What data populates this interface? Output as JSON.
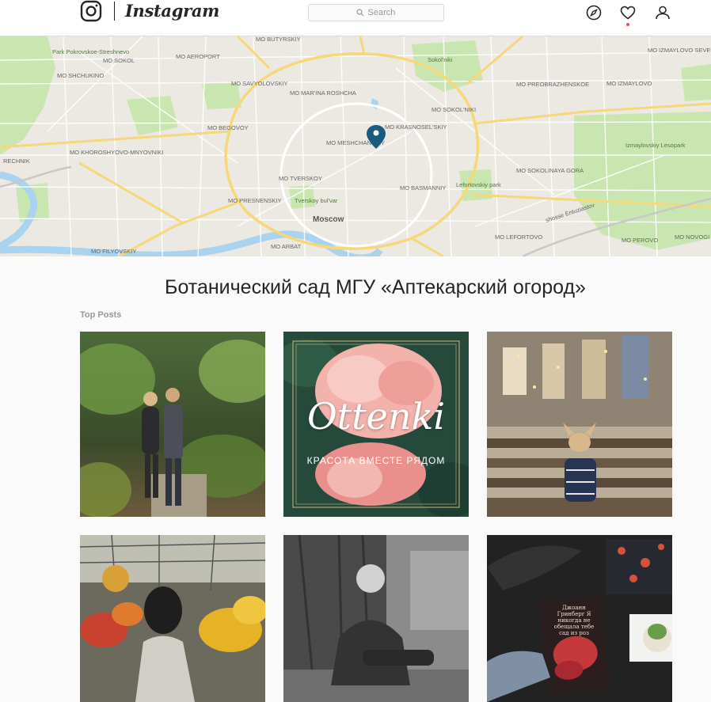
{
  "header": {
    "wordmark": "Instagram",
    "search_placeholder": "Search"
  },
  "map": {
    "labels": [
      {
        "text": "MO BUTYRSKIY"
      },
      {
        "text": "MO SOKOL"
      },
      {
        "text": "MO AEROPORT"
      },
      {
        "text": "MO SHCHUKINO"
      },
      {
        "text": "MO SAVYOLOVSKIY"
      },
      {
        "text": "MO MAR'INA ROSHCHA"
      },
      {
        "text": "MO BEGOVOY"
      },
      {
        "text": "MO MESHCHANSKIY"
      },
      {
        "text": "MO KRASNOSEL'SKIY"
      },
      {
        "text": "MO SOKOL'NIKI"
      },
      {
        "text": "MO PREOBRAZHENSKOE"
      },
      {
        "text": "MO IZMAYLOVO"
      },
      {
        "text": "MO IZMAYLOVO SEVERNOE"
      },
      {
        "text": "MO KHOROSHYOVO-MNYOVNIKI"
      },
      {
        "text": "MO TVERSKOY"
      },
      {
        "text": "MO PRESNENSKIY"
      },
      {
        "text": "MO BASMANNIY"
      },
      {
        "text": "MO SOKOLINAYA GORA"
      },
      {
        "text": "MO LEFORTOVO"
      },
      {
        "text": "MO PEROVO"
      },
      {
        "text": "MO NOVOGI"
      },
      {
        "text": "MO FILYOVSKIY"
      },
      {
        "text": "MO ARBAT"
      },
      {
        "text": "Moscow"
      },
      {
        "text": "shosse Entuziastov"
      },
      {
        "text": "Izmaylovskiy Lesopark"
      },
      {
        "text": "RECHNIK"
      },
      {
        "text": "Park Pokrovskoe-Streshnevo"
      },
      {
        "text": "Sokol'niki"
      },
      {
        "text": "Lefortovskiy park"
      },
      {
        "text": "Tverskoy bul'var"
      }
    ]
  },
  "location_title": "Ботанический сад МГУ «Аптекарский огород»",
  "section_label": "Top Posts",
  "posts": {
    "p2": {
      "title": "Ottenki",
      "subtitle": "КРАСОТА ВМЕСТЕ РЯДОМ"
    },
    "p6": {
      "book_title": "Джоанн Гринберг Я никогда не обещала тебе сад из роз"
    }
  },
  "colors": {
    "accent_pin": "#1a5b7e",
    "notification": "#ed4956",
    "park_green": "#c9e6b1",
    "water_blue": "#a9d3ee",
    "road_yellow": "#f6d77a"
  }
}
